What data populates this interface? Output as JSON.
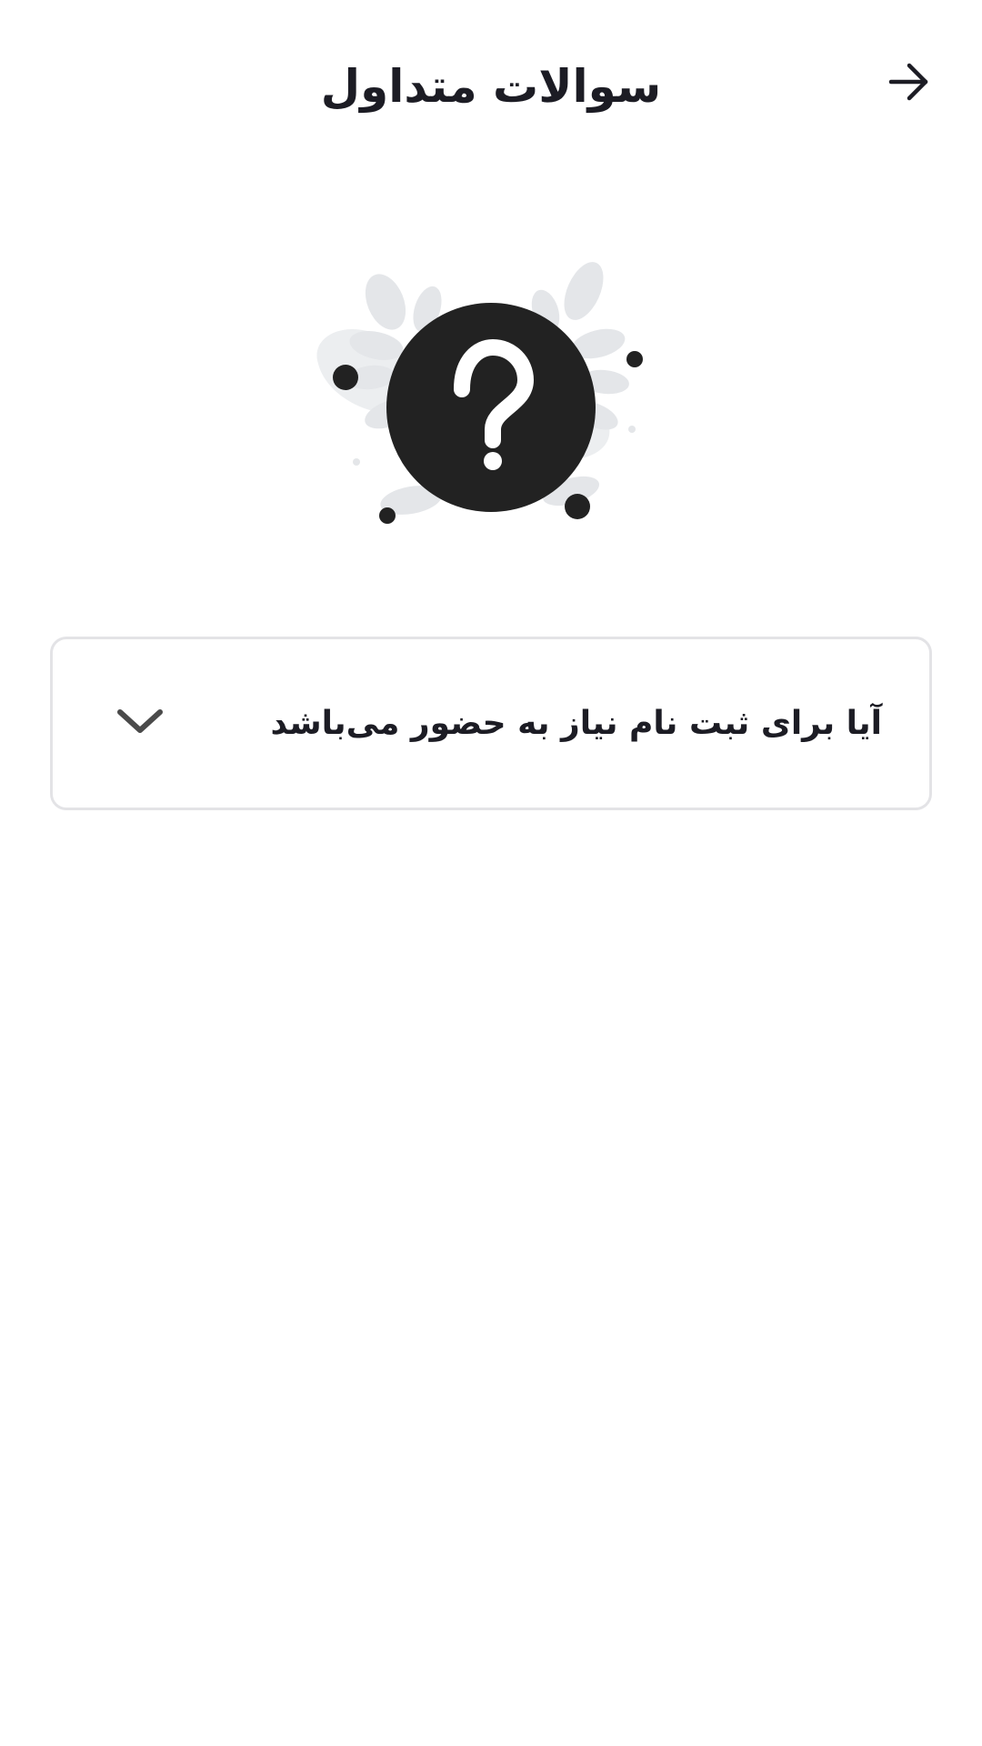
{
  "header": {
    "title": "سوالات متداول",
    "back_icon": "arrow-right-icon"
  },
  "illustration": {
    "icon": "question-mark-icon",
    "accent_color": "#222222",
    "leaf_color": "#e4e6e9"
  },
  "faq": {
    "items": [
      {
        "question": "آیا برای ثبت نام نیاز به حضور می‌باشد",
        "expanded": false,
        "toggle_icon": "chevron-down-icon"
      }
    ]
  },
  "colors": {
    "background": "#ffffff",
    "text": "#1c1c24",
    "card_border": "#e3e3e6"
  }
}
